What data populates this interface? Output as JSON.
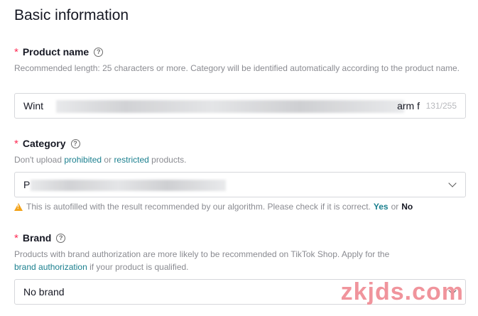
{
  "page_title": "Basic information",
  "product_name": {
    "required_mark": "*",
    "label": "Product name",
    "help_glyph": "?",
    "description": "Recommended length: 25 characters or more. Category will be identified automatically according to the product name.",
    "value_start": "Wint",
    "value_end": "arm f",
    "counter": "131/255"
  },
  "category": {
    "required_mark": "*",
    "label": "Category",
    "help_glyph": "?",
    "desc_prefix": "Don't upload",
    "desc_link_1": "prohibited",
    "desc_or": "or",
    "desc_link_2": "restricted",
    "desc_suffix": "products.",
    "value_start": "P",
    "autofill_notice": "This is autofilled with the result recommended by our algorithm. Please check if it is correct.",
    "yes_label": "Yes",
    "or_label": "or",
    "no_label": "No"
  },
  "brand": {
    "required_mark": "*",
    "label": "Brand",
    "help_glyph": "?",
    "desc_line1": "Products with brand authorization are more likely to be recommended on TikTok Shop. Apply for the",
    "desc_link": "brand authorization",
    "desc_line2_suffix": "if your product is qualified.",
    "value": "No brand"
  },
  "watermark": "zkjds.com",
  "colors": {
    "required": "#fe2c55",
    "link": "#1a7f8e",
    "warning": "#f3a31a"
  }
}
